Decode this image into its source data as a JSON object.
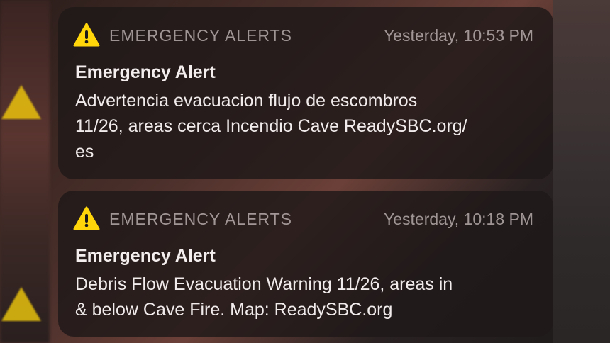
{
  "notifications": [
    {
      "app_name": "EMERGENCY ALERTS",
      "time": "Yesterday, 10:53 PM",
      "title": "Emergency Alert",
      "body": "Advertencia evacuacion flujo de escombros\n11/26, areas cerca Incendio Cave ReadySBC.org/\nes"
    },
    {
      "app_name": "EMERGENCY ALERTS",
      "time": "Yesterday, 10:18 PM",
      "title": "Emergency Alert",
      "body": "Debris Flow Evacuation Warning 11/26, areas in\n& below Cave Fire. Map: ReadySBC.org"
    }
  ],
  "colors": {
    "warning_yellow": "#FFD60A",
    "card_background": "#1E1818",
    "text_primary": "#F4EEEE",
    "text_secondary": "#B0A8A8"
  },
  "icons": [
    "warning-triangle-icon"
  ]
}
